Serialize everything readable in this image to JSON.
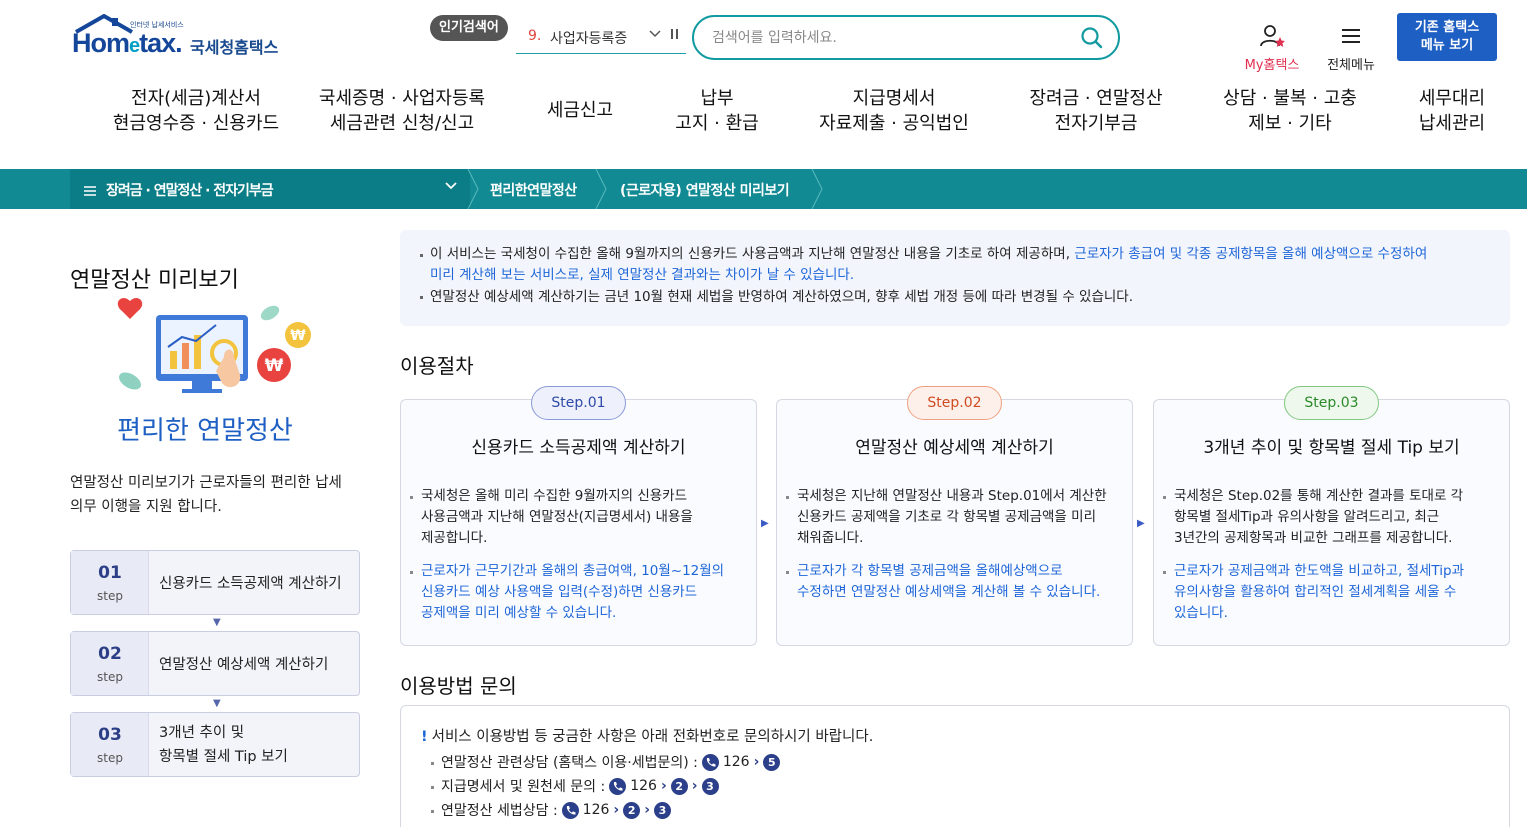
{
  "header": {
    "logo_sub": "인터넷 납세서비스",
    "logo_text_pre": "Hom",
    "logo_text_e": "e",
    "logo_text_post": "tax.",
    "logo_kr": "국세청홈택스",
    "popular_badge": "인기검색어",
    "popular_rank": "9.",
    "popular_word": "사업자등록증",
    "search_placeholder": "검색어를 입력하세요.",
    "my_label": "My홈택스",
    "allmenu_label": "전체메뉴",
    "old_menu_line1": "기존 홈택스",
    "old_menu_line2": "메뉴 보기"
  },
  "gnb": [
    {
      "l1": "전자(세금)계산서",
      "l2": "현금영수증 · 신용카드"
    },
    {
      "l1": "국세증명 · 사업자등록",
      "l2": "세금관련 신청/신고"
    },
    {
      "l1": "세금신고",
      "l2": ""
    },
    {
      "l1": "납부",
      "l2": "고지 · 환급"
    },
    {
      "l1": "지급명세서",
      "l2": "자료제출 · 공익법인"
    },
    {
      "l1": "장려금 · 연말정산",
      "l2": "전자기부금"
    },
    {
      "l1": "상담 · 불복 · 고충",
      "l2": "제보 · 기타"
    },
    {
      "l1": "세무대리",
      "l2": "납세관리"
    }
  ],
  "location": {
    "depth1": "장려금 · 연말정산 · 전자기부금",
    "depth2": "편리한연말정산",
    "depth3": "(근로자용) 연말정산 미리보기"
  },
  "side": {
    "title": "연말정산 미리보기",
    "headline": "편리한 연말정산",
    "desc_line1": "연말정산 미리보기가 근로자들의  편리한 납세",
    "desc_line2": "의무 이행을 지원 합니다.",
    "steps": [
      {
        "num": "01",
        "sub": "step",
        "line1": "신용카드 소득공제액 계산하기",
        "line2": ""
      },
      {
        "num": "02",
        "sub": "step",
        "line1": "연말정산 예상세액 계산하기",
        "line2": ""
      },
      {
        "num": "03",
        "sub": "step",
        "line1": "3개년 추이 및",
        "line2": "항목별 절세 Tip 보기"
      }
    ]
  },
  "notice": {
    "line1_a": "이 서비스는 국세청이 수집한 올해 9월까지의 신용카드 사용금액과 지난해 연말정산 내용을 기초로 하여 제공하며, ",
    "line1_b": "근로자가 총급여 및 각종 공제항목을 올해 예상액으로 수정하여",
    "line2": "미리 계산해 보는 서비스로, 실제 연말정산 결과와는 차이가 날 수 있습니다.",
    "line3": "연말정산 예상세액 계산하기는 금년 10월 현재 세법을 반영하여 계산하였으며, 향후 세법 개정 등에 따라 변경될 수 있습니다."
  },
  "procedure": {
    "title": "이용절차",
    "cards": [
      {
        "step": "Step.01",
        "title": "신용카드 소득공제액 계산하기",
        "d1": [
          "국세청은 올해 미리 수집한 9월까지의 신용카드",
          "사용금액과 지난해 연말정산(지급명세서) 내용을",
          "제공합니다."
        ],
        "d2": [
          "근로자가 근무기간과 올해의 총급여액, 10월~12월의",
          "신용카드 예상 사용액을 입력(수정)하면 신용카드",
          "공제액을 미리 예상할 수 있습니다."
        ]
      },
      {
        "step": "Step.02",
        "title": "연말정산 예상세액 계산하기",
        "d1": [
          "국세청은 지난해 연말정산 내용과 Step.01에서 계산한",
          "신용카드 공제액을 기초로 각 항목별 공제금액을 미리",
          "채워줍니다."
        ],
        "d2": [
          "근로자가 각 항목별 공제금액을 올해예상액으로",
          "수정하면 연말정산 예상세액을 계산해 볼 수 있습니다.",
          ""
        ]
      },
      {
        "step": "Step.03",
        "title": "3개년 추이 및 항목별 절세 Tip 보기",
        "d1": [
          "국세청은 Step.02를 통해 계산한 결과를 토대로 각",
          "항목별 절세Tip과 유의사항을 알려드리고, 최근",
          "3년간의 공제항목과 비교한 그래프를 제공합니다."
        ],
        "d2": [
          "근로자가 공제금액과 한도액을 비교하고, 절세Tip과",
          "유의사항을 활용하여 합리적인 절세계획을 세울 수",
          "있습니다."
        ]
      }
    ]
  },
  "inquiry": {
    "title": "이용방법 문의",
    "head_mark": "!",
    "head": "서비스 이용방법 등 궁금한 사항은 아래 전화번호로 문의하시기 바랍니다.",
    "rows": [
      {
        "label": "연말정산 관련상담 (홈택스 이용·세법문의) :",
        "number": "126",
        "keys": [
          "5"
        ]
      },
      {
        "label": "지급명세서 및 원천세 문의 :",
        "number": "126",
        "keys": [
          "2",
          "3"
        ]
      },
      {
        "label": "연말정산 세법상담 :",
        "number": "126",
        "keys": [
          "2",
          "3"
        ]
      }
    ]
  }
}
